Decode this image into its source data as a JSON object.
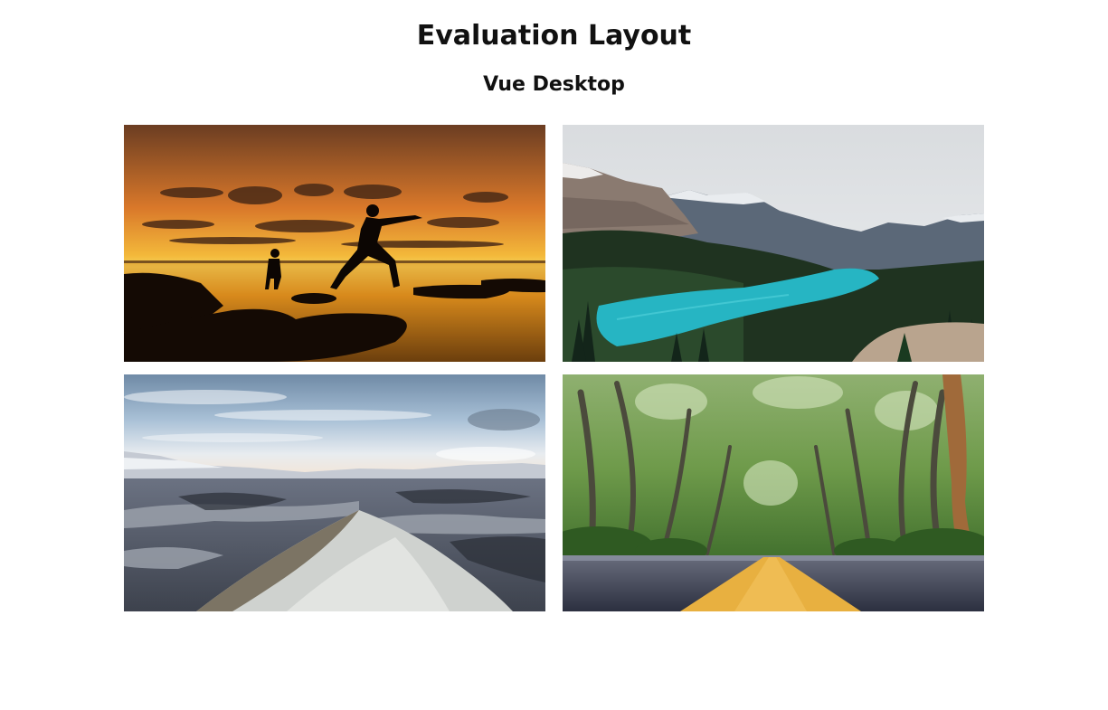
{
  "header": {
    "title": "Evaluation Layout",
    "subtitle": "Vue Desktop"
  },
  "gallery": {
    "images": [
      {
        "name": "sunset-jumping-silhouettes-image"
      },
      {
        "name": "mountain-lake-image"
      },
      {
        "name": "rocky-valley-landscape-image"
      },
      {
        "name": "tree-lined-road-image"
      }
    ]
  }
}
